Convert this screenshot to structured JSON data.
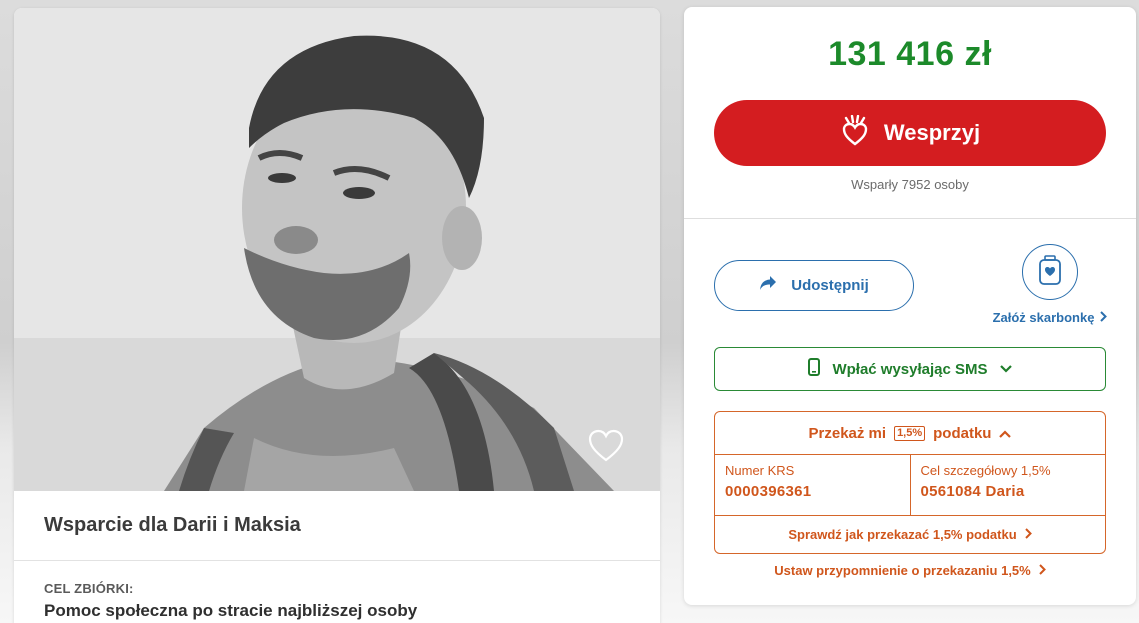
{
  "campaign": {
    "title": "Wsparcie dla Darii i Maksia",
    "goal_label": "CEL ZBIÓRKI:",
    "goal_value": "Pomoc społeczna po stracie najbliższej osoby"
  },
  "donation": {
    "amount": "131 416 zł",
    "support_label": "Wesprzyj",
    "supporters_text": "Wsparły 7952 osoby"
  },
  "actions": {
    "share_label": "Udostępnij",
    "piggy_label": "Załóż skarbonkę",
    "sms_label": "Wpłać wysyłając SMS"
  },
  "tax": {
    "header_prefix": "Przekaż mi",
    "header_badge": "1,5%",
    "header_suffix": "podatku",
    "krs_label": "Numer KRS",
    "krs_value": "0000396361",
    "goal_label": "Cel szczegółowy 1,5%",
    "goal_value": "0561084 Daria",
    "check_link": "Sprawdź jak przekazać 1,5% podatku",
    "reminder_link": "Ustaw przypomnienie o przekazaniu 1,5%"
  },
  "colors": {
    "accent_red": "#d41d20",
    "amount_green": "#1c8a2a",
    "link_blue": "#2b6fad",
    "tax_orange": "#d0561c"
  },
  "icons": [
    "heart-hand-icon",
    "share-arrow-icon",
    "piggy-bank-icon",
    "chevron-right-icon",
    "phone-icon",
    "chevron-down-icon",
    "chevron-up-icon",
    "favorite-heart-icon"
  ]
}
